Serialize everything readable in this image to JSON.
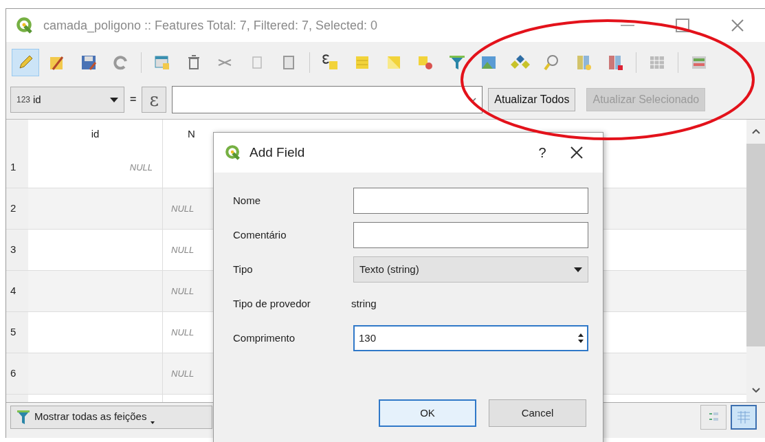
{
  "window": {
    "title": "camada_poligono :: Features Total: 7, Filtered: 7, Selected: 0"
  },
  "toolbar": [
    {
      "pressed": true
    },
    {
      "pressed": false
    },
    {
      "pressed": false
    },
    {
      "pressed": false
    },
    {
      "pressed": false
    },
    {
      "pressed": false
    },
    {
      "pressed": false
    },
    {
      "pressed": false
    },
    {
      "pressed": false
    },
    {
      "pressed": false
    },
    {
      "pressed": false
    },
    {
      "pressed": false
    },
    {
      "pressed": false
    },
    {
      "pressed": false
    },
    {
      "pressed": false
    },
    {
      "pressed": false
    },
    {
      "pressed": false
    },
    {
      "pressed": false
    },
    {
      "pressed": false
    },
    {
      "pressed": false
    },
    {
      "pressed": false
    }
  ],
  "filter_bar": {
    "field_type": "123",
    "field": "id",
    "operator": "=",
    "expression_button": "ε",
    "buttons": [
      {
        "label": "Atualizar Todos",
        "disabled": false
      },
      {
        "label": "Atualizar Selecionado",
        "disabled": true
      }
    ]
  },
  "table": {
    "columns": [
      "id",
      "N"
    ],
    "rows": [
      {
        "number": "1",
        "id": "NULL"
      },
      {
        "number": "2",
        "column_2": "NULL"
      },
      {
        "number": "3",
        "column_2": "NULL"
      },
      {
        "number": "4",
        "column_2": "NULL"
      },
      {
        "number": "5",
        "column_2": "NULL"
      },
      {
        "number": "6",
        "column_2": "NULL"
      }
    ]
  },
  "status_bar": {
    "filter_button": "Mostrar todas as feições",
    "view_toggles": [
      {
        "selected": false
      },
      {
        "selected": true
      }
    ]
  },
  "dialog": {
    "title": "Add Field",
    "help": "?",
    "rows": [
      {
        "kind": "text",
        "label": "Nome",
        "focused": false
      },
      {
        "kind": "text",
        "label": "Comentário",
        "focused": false
      },
      {
        "kind": "select",
        "label": "Tipo",
        "value": "Texto (string)",
        "focused": false
      },
      {
        "kind": "static",
        "label": "Tipo de provedor",
        "value": "string"
      },
      {
        "kind": "spin",
        "label": "Comprimento",
        "value": "130",
        "focused": true
      }
    ],
    "buttons": [
      {
        "label": "OK",
        "default": true
      },
      {
        "label": "Cancel",
        "default": false
      }
    ]
  },
  "annotations": [
    {
      "kind": "ellipse"
    }
  ]
}
